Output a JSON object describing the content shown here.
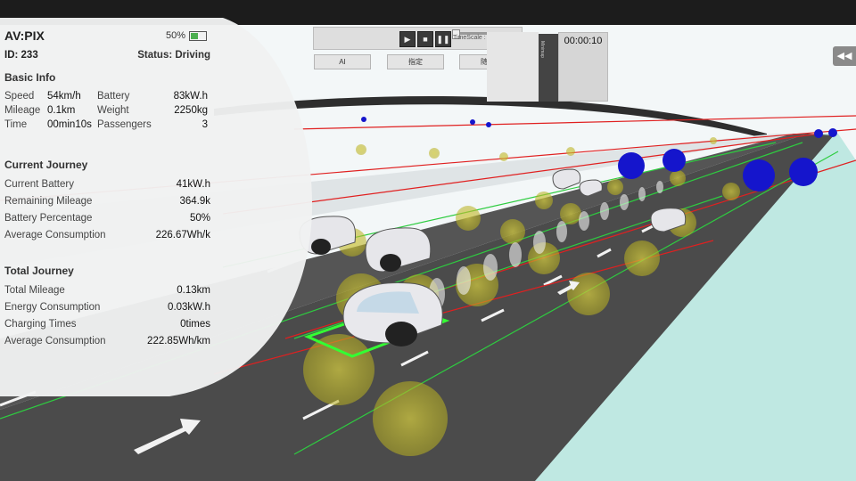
{
  "vehicle": {
    "name": "AV:PIX",
    "id_label": "ID: 233",
    "status_label": "Status: Driving",
    "battery_pct_label": "50%",
    "battery_fraction": 0.5
  },
  "basic_info": {
    "header": "Basic Info",
    "speed_label": "Speed",
    "speed_value": "54km/h",
    "battery_label": "Battery",
    "battery_value": "83kW.h",
    "mileage_label": "Mileage",
    "mileage_value": "0.1km",
    "weight_label": "Weight",
    "weight_value": "2250kg",
    "time_label": "Time",
    "time_value": "00min10s",
    "passengers_label": "Passengers",
    "passengers_value": "3"
  },
  "current_journey": {
    "header": "Current Journey",
    "rows": [
      {
        "k": "Current Battery",
        "v": "41kW.h"
      },
      {
        "k": "Remaining Mileage",
        "v": "364.9k"
      },
      {
        "k": "Battery Percentage",
        "v": "50%"
      },
      {
        "k": "Average Consumption",
        "v": "226.67Wh/k"
      }
    ]
  },
  "total_journey": {
    "header": "Total Journey",
    "rows": [
      {
        "k": "Total Mileage",
        "v": "0.13km"
      },
      {
        "k": "Energy Consumption",
        "v": "0.03kW.h"
      },
      {
        "k": "Charging Times",
        "v": "0times"
      },
      {
        "k": "Average Consumption",
        "v": "222.85Wh/km"
      }
    ]
  },
  "controls": {
    "timescale_label": "TimeScale : 1",
    "mode_buttons": [
      "AI",
      "指定",
      "随机"
    ],
    "timer": "00:00:10",
    "minimap_label": "Minimap",
    "back_icon": "rewind-icon"
  },
  "colors": {
    "panel_bg": "#f2f2f2",
    "road": "#4a4a4a",
    "ground": "#eef6f6",
    "water": "#b8e6e0",
    "lane_green": "#2ecc40",
    "lane_red": "#e02020",
    "sensor_yellow": "#c8c020",
    "marker_blue": "#1010d0"
  }
}
